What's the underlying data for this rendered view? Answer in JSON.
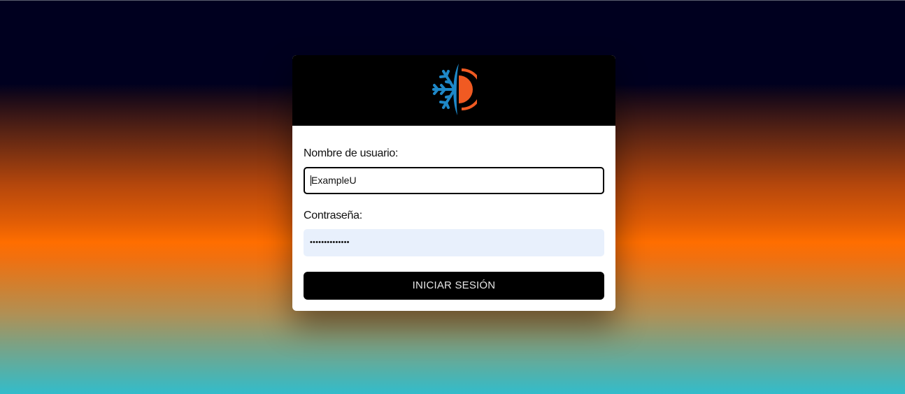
{
  "login": {
    "username_label": "Nombre de usuario:",
    "username_value": "ExampleU",
    "password_label": "Contraseña:",
    "password_masked": "••••••••••••••",
    "submit_label": "INICIAR SESIÓN"
  },
  "logo": {
    "icon": "snowflake-sun-logo",
    "colors": {
      "snowflake": "#1e88c8",
      "sun": "#f05a22",
      "header": "#000000"
    }
  },
  "colors": {
    "background_top": "#00001f",
    "background_mid": "#ff6e00",
    "background_bottom": "#32bccb",
    "autofill": "#e8f0fc"
  }
}
